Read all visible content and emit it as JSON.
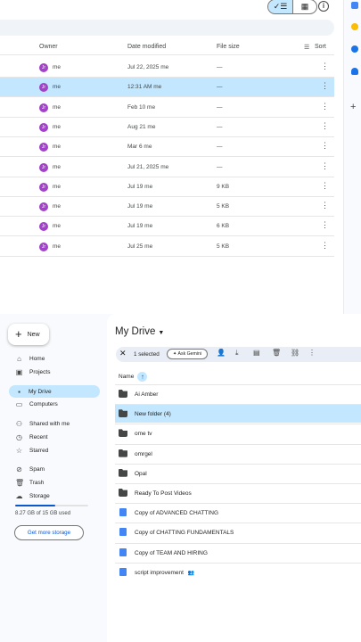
{
  "top_panel": {
    "view_toggle": {
      "list_icon": "check-list-icon",
      "grid_icon": "grid-icon"
    },
    "info_icon": "info-icon",
    "columns": {
      "owner": "Owner",
      "date": "Date modified",
      "size": "File size",
      "sort": "Sort"
    },
    "rows": [
      {
        "owner": "me",
        "date": "Jul 22, 2025 me",
        "size": "—",
        "selected": false
      },
      {
        "owner": "me",
        "date": "12:31 AM me",
        "size": "—",
        "selected": true
      },
      {
        "owner": "me",
        "date": "Feb 10 me",
        "size": "—",
        "selected": false
      },
      {
        "owner": "me",
        "date": "Aug 21 me",
        "size": "—",
        "selected": false
      },
      {
        "owner": "me",
        "date": "Mar 6 me",
        "size": "—",
        "selected": false
      },
      {
        "owner": "me",
        "date": "Jul 21, 2025 me",
        "size": "—",
        "selected": false
      },
      {
        "owner": "me",
        "date": "Jul 19 me",
        "size": "9 KB",
        "selected": false
      },
      {
        "owner": "me",
        "date": "Jul 19 me",
        "size": "5 KB",
        "selected": false
      },
      {
        "owner": "me",
        "date": "Jul 19 me",
        "size": "6 KB",
        "selected": false
      },
      {
        "owner": "me",
        "date": "Jul 25 me",
        "size": "5 KB",
        "selected": false
      }
    ],
    "avatar_letter": "Jr"
  },
  "sidebar": {
    "new_label": "New",
    "items": [
      {
        "label": "Home",
        "icon": "home-icon"
      },
      {
        "label": "Projects",
        "icon": "projects-icon"
      },
      {
        "label": "My Drive",
        "icon": "my-drive-icon"
      },
      {
        "label": "Computers",
        "icon": "computers-icon"
      },
      {
        "label": "Shared with me",
        "icon": "shared-icon"
      },
      {
        "label": "Recent",
        "icon": "clock-icon"
      },
      {
        "label": "Starred",
        "icon": "star-icon"
      },
      {
        "label": "Spam",
        "icon": "spam-icon"
      },
      {
        "label": "Trash",
        "icon": "trash-icon"
      },
      {
        "label": "Storage",
        "icon": "cloud-icon"
      }
    ],
    "storage_used_fraction": 0.55,
    "storage_text": "8.27 GB of 15 GB used",
    "get_storage": "Get more storage"
  },
  "main": {
    "title": "My Drive",
    "action_bar": {
      "selected": "1 selected",
      "gemini": "Ask Gemini"
    },
    "name_header": "Name",
    "files": [
      {
        "name": "Ai Amber",
        "type": "shared-folder",
        "selected": false
      },
      {
        "name": "New folder (4)",
        "type": "shared-folder",
        "selected": true
      },
      {
        "name": "ome tv",
        "type": "shared-folder",
        "selected": false
      },
      {
        "name": "omrgel",
        "type": "folder",
        "selected": false
      },
      {
        "name": "Opal",
        "type": "folder",
        "selected": false
      },
      {
        "name": "Ready To Post Videos",
        "type": "folder",
        "selected": false
      },
      {
        "name": "Copy of ADVANCED CHATTING",
        "type": "doc",
        "selected": false
      },
      {
        "name": "Copy of CHATTING FUNDAMENTALS",
        "type": "doc",
        "selected": false
      },
      {
        "name": "Copy of TEAM AND HIRING",
        "type": "doc",
        "selected": false
      },
      {
        "name": "script improvement",
        "type": "doc",
        "selected": false,
        "shared": true
      }
    ]
  },
  "colors": {
    "accent": "#0b57d0",
    "selection": "#c2e7ff",
    "avatar": "#a142c9",
    "doc": "#4285f4"
  }
}
